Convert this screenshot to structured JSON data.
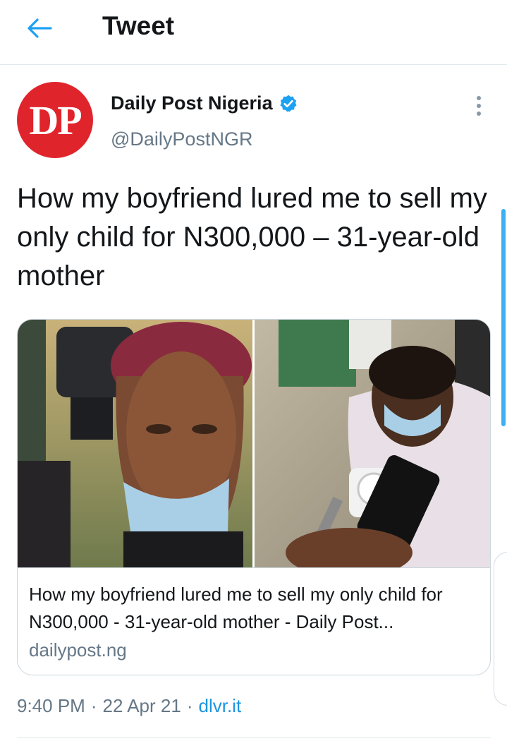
{
  "header": {
    "title": "Tweet"
  },
  "tweet": {
    "author": {
      "avatar_text": "DP",
      "name": "Daily Post Nigeria",
      "handle": "@DailyPostNGR",
      "verified": true
    },
    "text": "How my boyfriend lured me to sell my only child for N300,000 – 31-year-old mother",
    "card": {
      "title": "How my boyfriend lured me to sell my only child for N300,000 - 31-year-old mother - Daily Post...",
      "domain": "dailypost.ng"
    },
    "meta": {
      "time": "9:40 PM",
      "sep1": "·",
      "date": "22 Apr 21",
      "sep2": "·",
      "source": "dlvr.it"
    }
  },
  "colors": {
    "accent": "#1da1f2",
    "brand_red": "#e0242c",
    "secondary_text": "#657786"
  }
}
